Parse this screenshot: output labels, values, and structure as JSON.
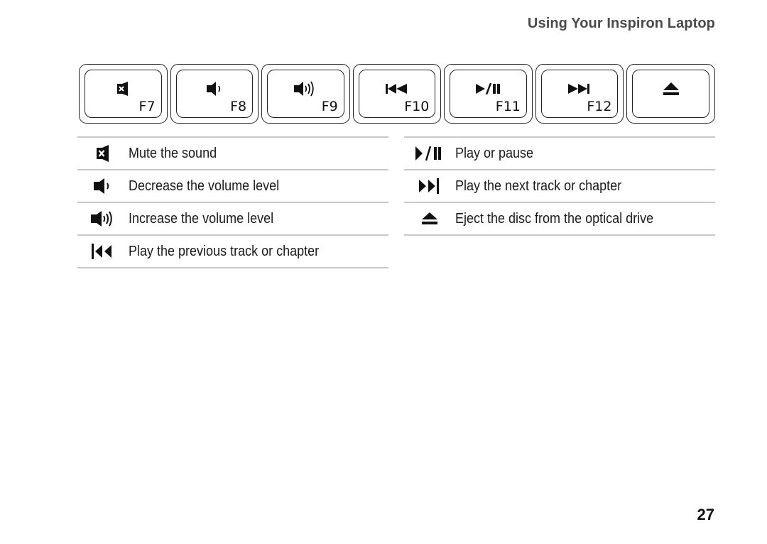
{
  "header": {
    "title": "Using Your Inspiron Laptop"
  },
  "keyboard": {
    "keys": [
      {
        "label": "F7",
        "icon": "mute-icon"
      },
      {
        "label": "F8",
        "icon": "volume-down-icon"
      },
      {
        "label": "F9",
        "icon": "volume-up-icon"
      },
      {
        "label": "F10",
        "icon": "previous-track-icon"
      },
      {
        "label": "F11",
        "icon": "play-pause-icon"
      },
      {
        "label": "F12",
        "icon": "next-track-icon"
      },
      {
        "label": "",
        "icon": "eject-icon"
      }
    ]
  },
  "descriptions": {
    "left": [
      {
        "icon": "mute-icon",
        "text": "Mute the sound"
      },
      {
        "icon": "volume-down-icon",
        "text": "Decrease the volume level"
      },
      {
        "icon": "volume-up-icon",
        "text": "Increase the volume level"
      },
      {
        "icon": "previous-track-icon",
        "text": "Play the previous track or chapter"
      }
    ],
    "right": [
      {
        "icon": "play-pause-icon",
        "text": "Play or pause"
      },
      {
        "icon": "next-track-icon",
        "text": "Play the next track or chapter"
      },
      {
        "icon": "eject-icon",
        "text": "Eject the disc from the optical drive"
      }
    ]
  },
  "footer": {
    "page_number": "27"
  }
}
